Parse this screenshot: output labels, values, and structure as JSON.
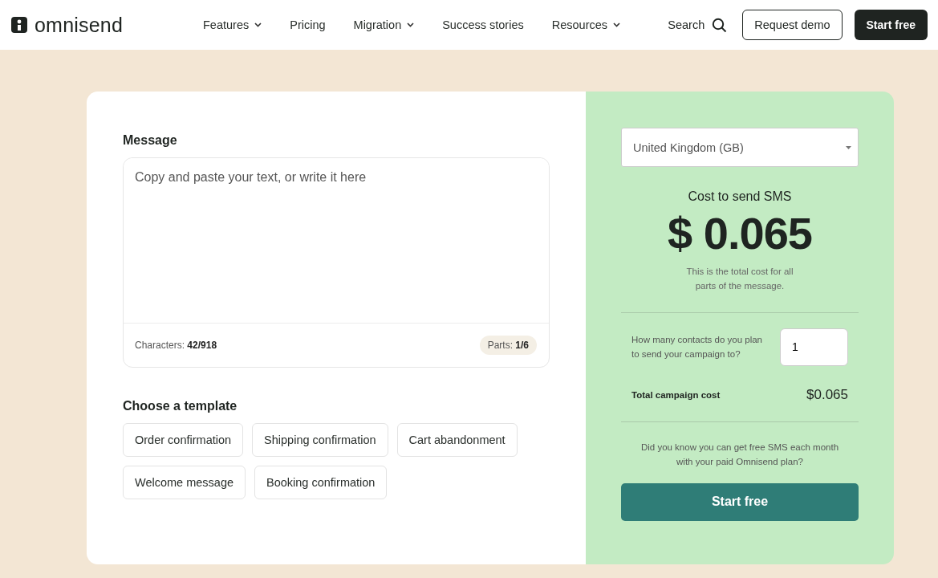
{
  "header": {
    "logo": "omnisend",
    "nav": [
      {
        "label": "Features",
        "dropdown": true
      },
      {
        "label": "Pricing",
        "dropdown": false
      },
      {
        "label": "Migration",
        "dropdown": true
      },
      {
        "label": "Success stories",
        "dropdown": false
      },
      {
        "label": "Resources",
        "dropdown": true
      }
    ],
    "search": "Search",
    "request_demo": "Request demo",
    "start_free": "Start free"
  },
  "message": {
    "heading": "Message",
    "placeholder": "Copy and paste your text, or write it here",
    "characters": "Characters: **42/918**",
    "parts": "Parts: **1/6**"
  },
  "templates": {
    "heading": "Choose a template",
    "items": [
      "Order confirmation",
      "Shipping confirmation",
      "Cart abandonment",
      "Welcome message",
      "Booking confirmation"
    ]
  },
  "cost": {
    "country": "United Kingdom (GB)",
    "title": "Cost to send SMS",
    "amount": "$ 0.065",
    "note": "This is the total cost for all parts of the message.",
    "contacts_label": "How many contacts do you plan to send your campaign to?",
    "contacts_value": "1",
    "total_label": "Total campaign cost",
    "total_value": "$0.065",
    "promo": "Did you know you can get free SMS each month with your paid Omnisend plan?",
    "cta": "Start free"
  }
}
